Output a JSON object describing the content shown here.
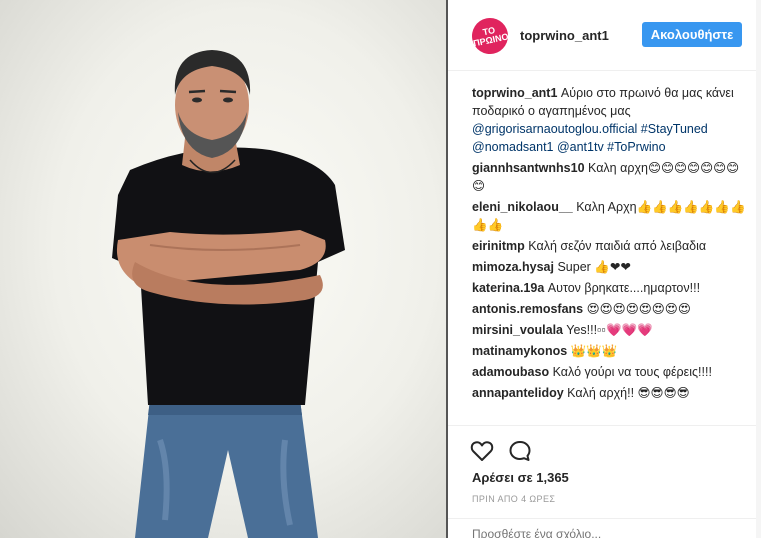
{
  "post": {
    "username": "toprwino_ant1",
    "avatar_text": "ΤΟ ΠΡΩΙΝΟ",
    "follow_label": "Ακολουθήστε",
    "caption": {
      "username": "toprwino_ant1",
      "text": "Αύριο στο πρωινό θα μας κάνει ποδαρικό ο αγαπημένος μας",
      "mentions": "@grigorisarnaoutoglou.official #StayTuned @nomadsant1 @ant1tv #ToPrwino"
    },
    "comments": [
      {
        "user": "giannhsantwnhs10",
        "text": "Καλη αρχη😊😊😊😊😊😊😊😊"
      },
      {
        "user": "eleni_nikolaou__",
        "text": "Καλη Αρχη👍👍👍👍👍👍👍👍👍"
      },
      {
        "user": "eirinitmp",
        "text": "Καλή σεζόν παιδιά από λειβαδια"
      },
      {
        "user": "mimoza.hysaj",
        "text": "Super 👍❤❤"
      },
      {
        "user": "katerina.19a",
        "text": "Αυτον βρηκατε....ημαρτον!!!"
      },
      {
        "user": "antonis.remosfans",
        "text": "😍😍😍😍😍😍😍😍"
      },
      {
        "user": "mirsini_voulala",
        "text": "Yes!!!▫▫💗💗💗"
      },
      {
        "user": "matinamykonos",
        "text": "👑👑👑"
      },
      {
        "user": "adamoubaso",
        "text": "Καλό γούρι να τους φέρεις!!!!"
      },
      {
        "user": "annapantelidoy",
        "text": "Καλή αρχή!! 😎😎😎😎"
      }
    ],
    "likes": "Αρέσει σε 1,365",
    "time_ago": "ΠΡΙΝ ΑΠΟ 4 ΩΡΕΣ",
    "add_comment_placeholder": "Προσθέστε ένα σχόλιο..."
  },
  "icons": {
    "heart": "heart-icon",
    "comment": "comment-icon"
  },
  "colors": {
    "follow_button": "#3897f0",
    "avatar": "#e0245e",
    "link": "#003569"
  }
}
